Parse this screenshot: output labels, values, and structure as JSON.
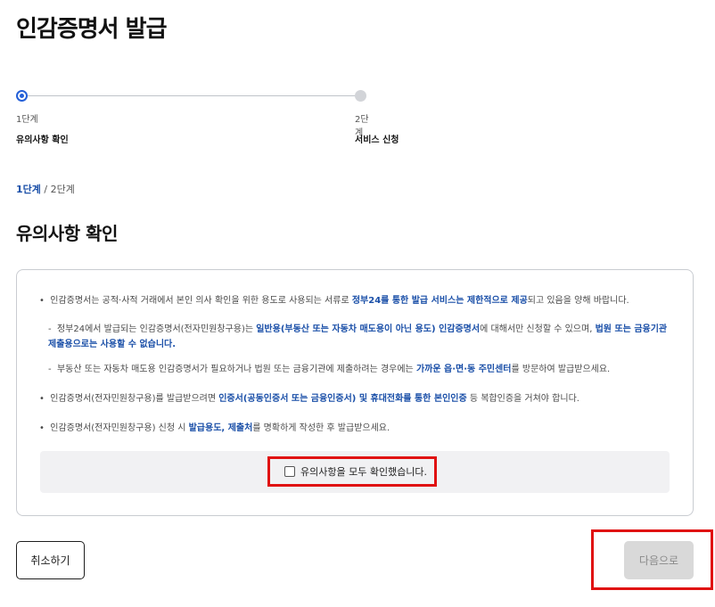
{
  "page": {
    "title": "인감증명서 발급"
  },
  "stepper": {
    "steps": [
      {
        "number": "1단계",
        "name": "유의사항 확인",
        "state": "active"
      },
      {
        "number": "2단계",
        "name": "서비스 신청",
        "state": "inactive"
      }
    ],
    "accent_color": "#2560d8"
  },
  "breadcrumb": {
    "current": "1단계",
    "separator": " / ",
    "next": "2단계"
  },
  "section": {
    "title": "유의사항 확인"
  },
  "notices": {
    "n1": {
      "a": "인감증명서는 공적·사적 거래에서 본인 의사 확인을 위한 용도로 사용되는 서류로 ",
      "b": "정부24를 통한 발급 서비스는 제한적으로 제공",
      "c": "되고 있음을 양해 바랍니다."
    },
    "n2": {
      "a": "정부24에서 발급되는 인감증명서(전자민원창구용)는 ",
      "b": "일반용(부동산 또는 자동차 매도용이 아닌 용도) 인감증명서",
      "c": "에 대해서만 신청할 수 있으며, ",
      "d": "법원 또는 금융기관 제출용으로는 사용할 수 없습니다."
    },
    "n3": {
      "a": "부동산 또는 자동차 매도용 인감증명서가 필요하거나 법원 또는 금융기관에 제출하려는 경우에는 ",
      "b": "가까운 읍·면·동 주민센터",
      "c": "를 방문하여 발급받으세요."
    },
    "n4": {
      "a": "인감증명서(전자민원창구용)를 발급받으려면 ",
      "b": "인증서(공동인증서 또는 금융인증서) 및 휴대전화를 통한 본인인증",
      "c": " 등 복합인증을 거쳐야 합니다."
    },
    "n5": {
      "a": "인감증명서(전자민원창구용) 신청 시 ",
      "b": "발급용도, 제출처",
      "c": "를 명확하게 작성한 후 발급받으세요."
    }
  },
  "confirm": {
    "label": "유의사항을 모두 확인했습니다.",
    "checked": false
  },
  "buttons": {
    "cancel": "취소하기",
    "next": "다음으로"
  },
  "colors": {
    "highlight": "#1a4fa8",
    "annotation_box": "#e01111"
  }
}
